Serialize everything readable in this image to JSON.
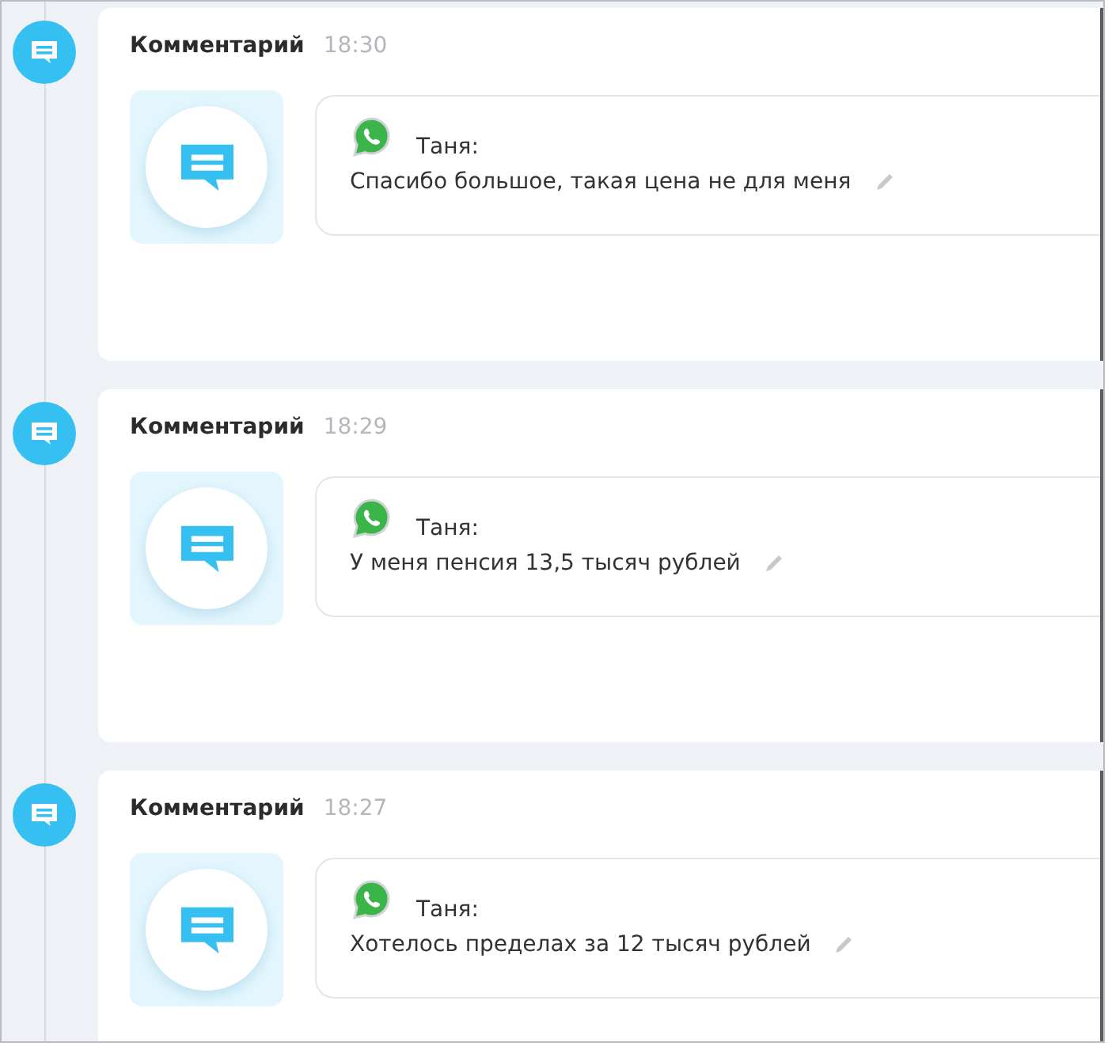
{
  "entries": [
    {
      "type": "Комментарий",
      "time": "18:30",
      "author": "Таня:",
      "message": "Спасибо большое, такая цена не для меня"
    },
    {
      "type": "Комментарий",
      "time": "18:29",
      "author": "Таня:",
      "message": "У меня пенсия 13,5 тысяч рублей"
    },
    {
      "type": "Комментарий",
      "time": "18:27",
      "author": "Таня:",
      "message": "Хотелось пределах за 12 тысяч рублей"
    }
  ]
}
